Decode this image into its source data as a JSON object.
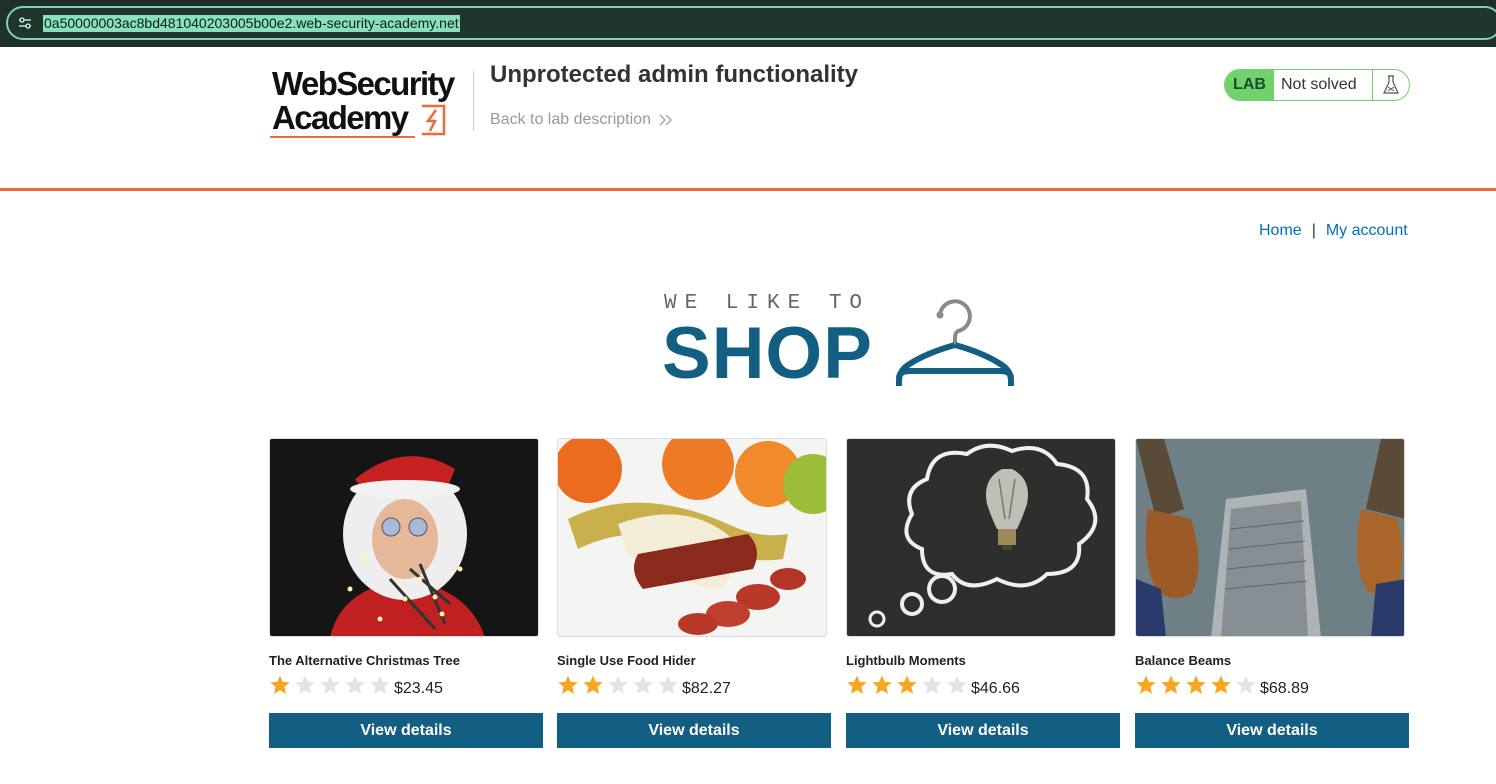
{
  "browser": {
    "url": "0a50000003ac8bd481040203005b00e2.web-security-academy.net"
  },
  "header": {
    "logo_line1": "WebSecurity",
    "logo_line2": "Academy",
    "lab_title": "Unprotected admin functionality",
    "back_link": "Back to lab description",
    "lab_badge": "LAB",
    "lab_status": "Not solved"
  },
  "nav": {
    "home": "Home",
    "separator": "|",
    "my_account": "My account"
  },
  "shop_logo": {
    "tagline": "WE LIKE TO",
    "word": "SHOP"
  },
  "colors": {
    "brand_orange": "#ec6b3a",
    "shop_blue": "#135e83",
    "lab_green": "#70d16d",
    "star_gold": "#f5a623",
    "star_empty": "#e3e3e3"
  },
  "products": [
    {
      "name": "The Alternative Christmas Tree",
      "rating": 1,
      "price": "$23.45",
      "button": "View details",
      "image": "santa-lights-photo"
    },
    {
      "name": "Single Use Food Hider",
      "rating": 2,
      "price": "$82.27",
      "button": "View details",
      "image": "banana-sausage-photo"
    },
    {
      "name": "Lightbulb Moments",
      "rating": 3,
      "price": "$46.66",
      "button": "View details",
      "image": "lightbulb-chalkboard-photo"
    },
    {
      "name": "Balance Beams",
      "rating": 4,
      "price": "$68.89",
      "button": "View details",
      "image": "shoes-skyscraper-photo"
    }
  ]
}
